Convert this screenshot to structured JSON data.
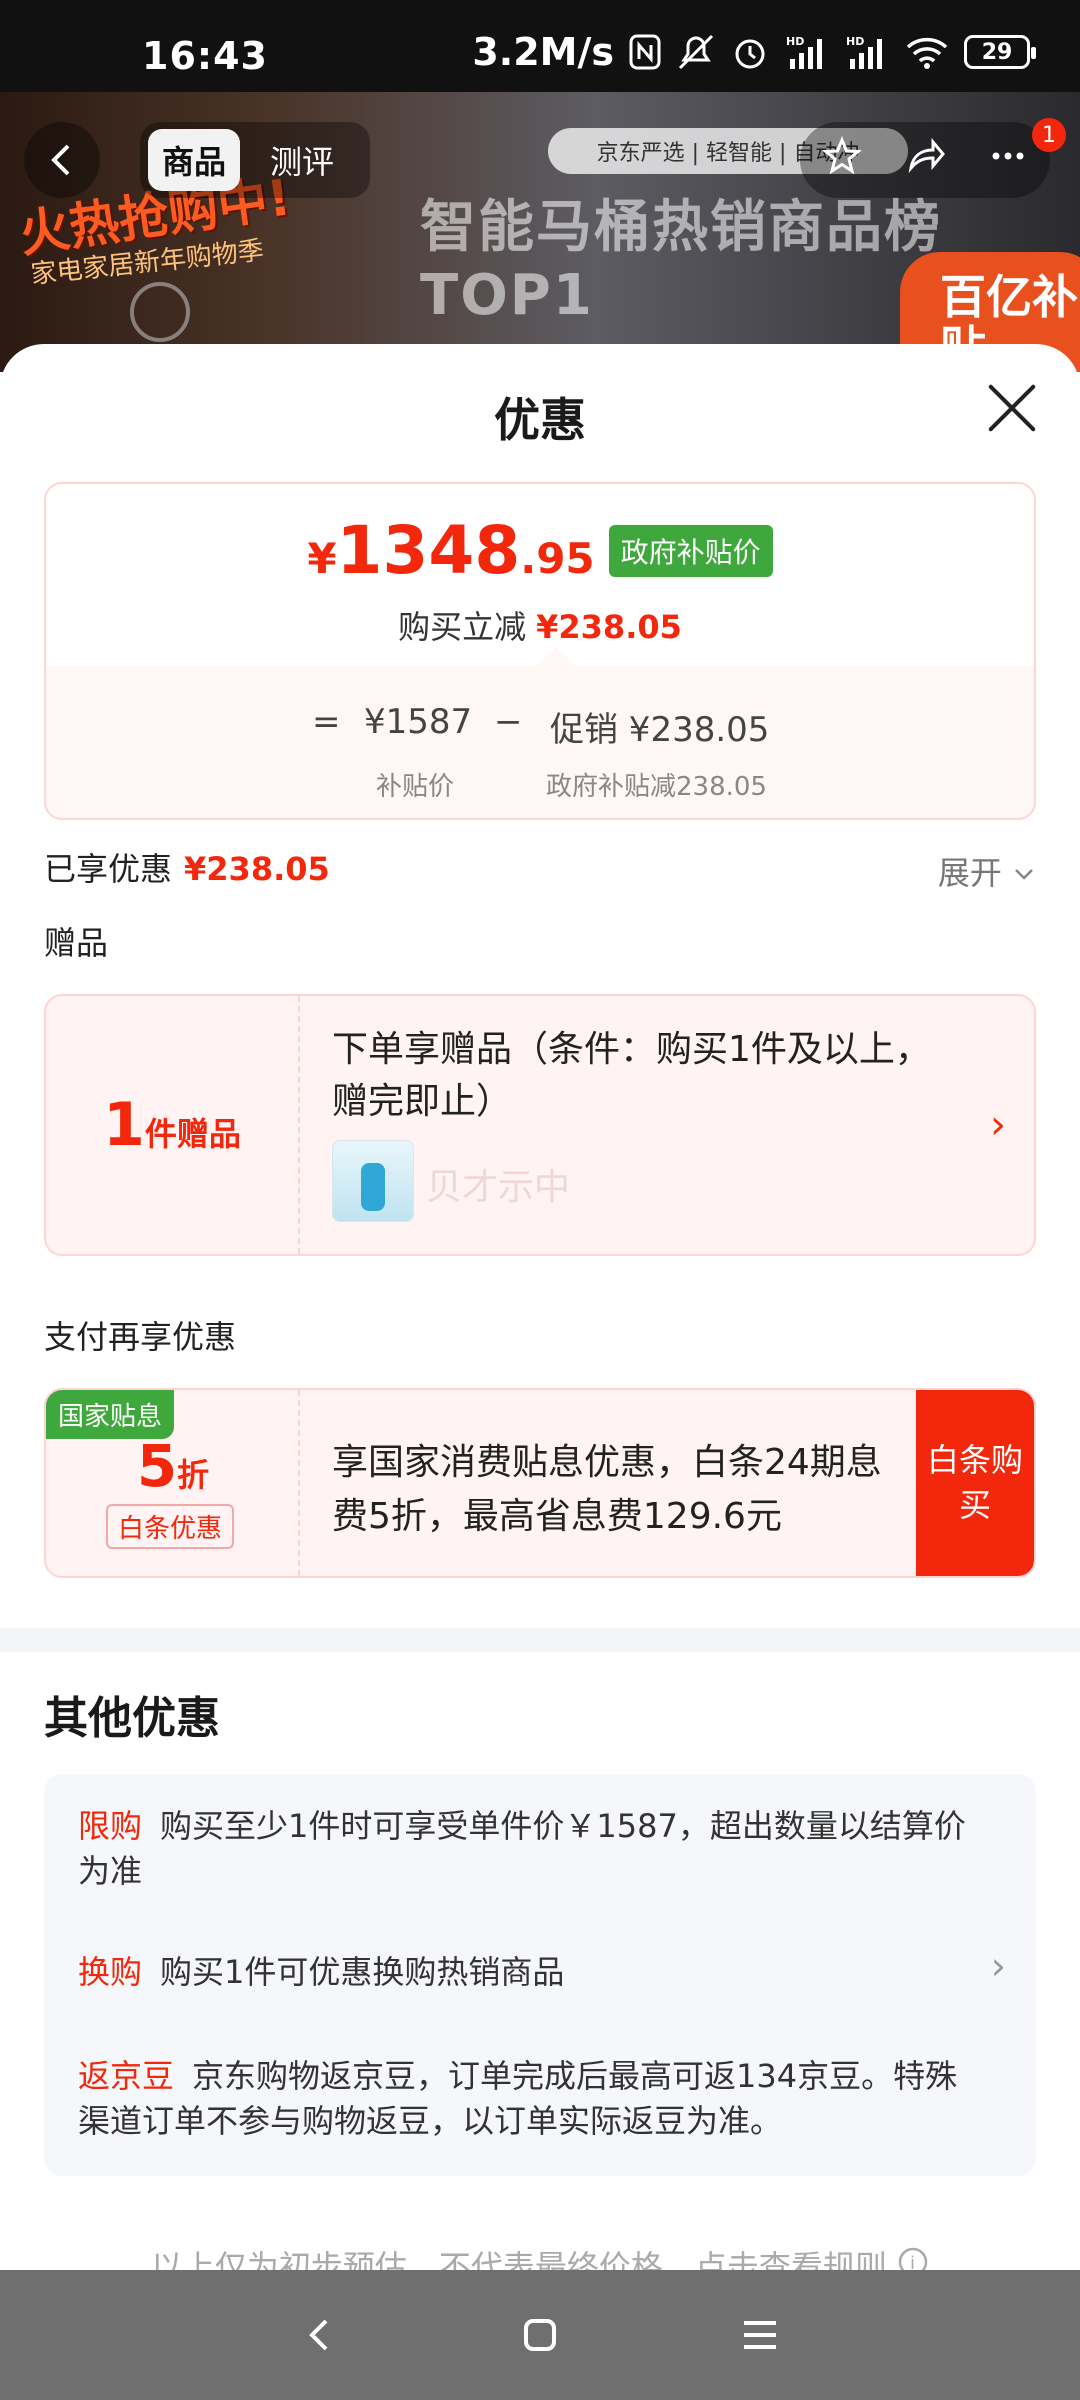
{
  "status_bar": {
    "time": "16:43",
    "speed": "3.2M/s",
    "battery": "29"
  },
  "header": {
    "tabs": [
      "商品",
      "测评"
    ],
    "badge_count": "1",
    "banner_promo": "火热抢购中!",
    "banner_promo_sub": "家电家居新年购物季",
    "banner_rank": "智能马桶热销商品榜TOP1",
    "banner_strip": "京东严选 | 轻智能 | 自动冲",
    "banner_subsidy": "百亿补贴"
  },
  "sheet": {
    "title": "优惠",
    "price": {
      "currency": "¥",
      "integer": "1348",
      "decimal": ".95",
      "tag": "政府补贴价"
    },
    "reduce": {
      "label": "购买立减",
      "amount": "¥238.05"
    },
    "calc": {
      "equals": "=",
      "base": "¥1587",
      "base_label": "补贴价",
      "minus": "−",
      "promo": "促销 ¥238.05",
      "promo_label": "政府补贴减238.05"
    },
    "enjoyed": {
      "label": "已享优惠",
      "amount": "¥238.05",
      "expand": "展开"
    },
    "gift": {
      "section": "赠品",
      "count": "1",
      "unit": "件赠品",
      "desc": "下单享赠品（条件：购买1件及以上，赠完即止）",
      "watermark": "贝才示中"
    },
    "pay": {
      "section": "支付再享优惠",
      "gov_badge": "国家贴息",
      "discount": "5",
      "discount_unit": "折",
      "bt_tag": "白条优惠",
      "desc": "享国家消费贴息优惠，白条24期息费5折，最高省息费129.6元",
      "button": "白条购买"
    },
    "other": {
      "title": "其他优惠",
      "items": [
        {
          "label": "限购",
          "text": "购买至少1件时可享受单件价￥1587，超出数量以结算价为准"
        },
        {
          "label": "换购",
          "text": "购买1件可优惠换购热销商品"
        },
        {
          "label": "返京豆",
          "text": "京东购物返京豆，订单完成后最高可返134京豆。特殊渠道订单不参与购物返豆，以订单实际返豆为准。"
        }
      ]
    },
    "footnote": "以上仅为初步预估，不代表最终价格，点击查看规则"
  }
}
